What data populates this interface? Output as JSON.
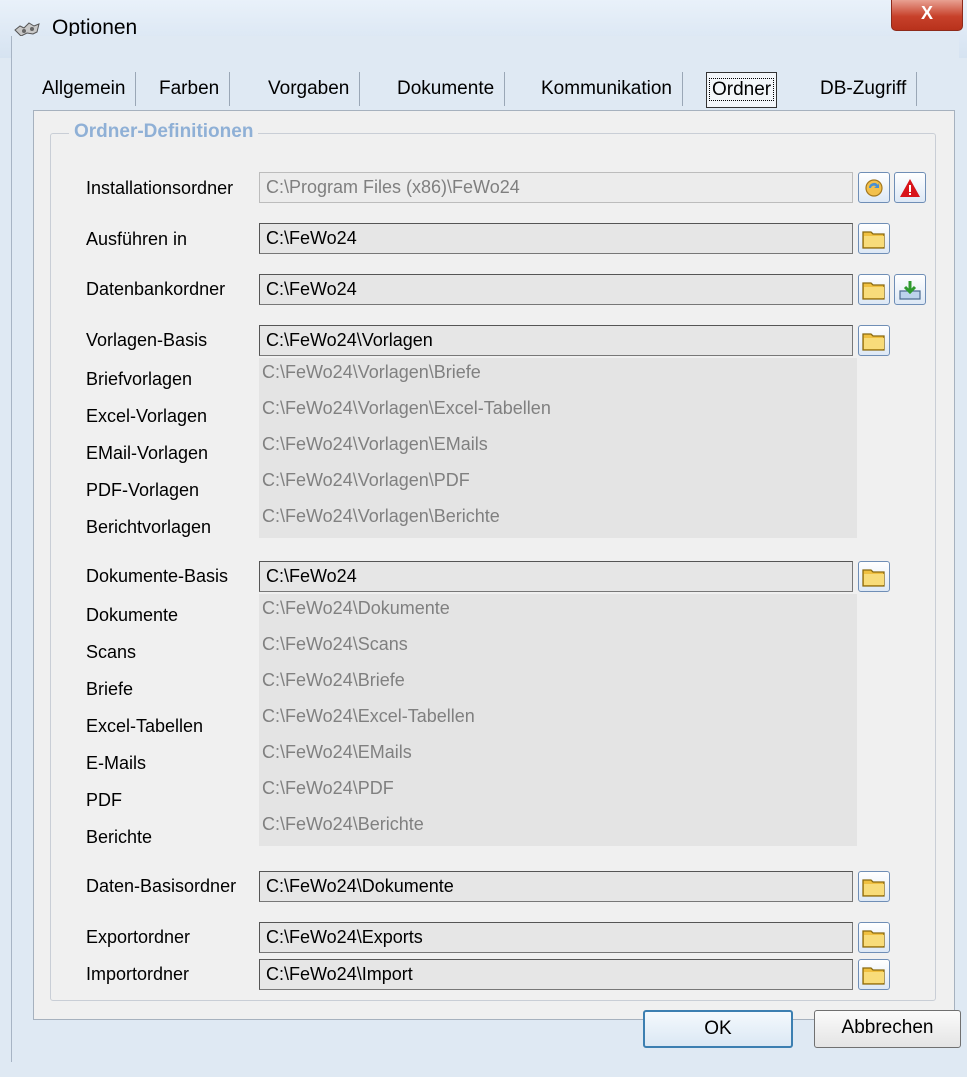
{
  "window": {
    "title": "Optionen",
    "close_label": "X"
  },
  "tabs": [
    {
      "label": "Allgemein"
    },
    {
      "label": "Farben"
    },
    {
      "label": "Vorgaben"
    },
    {
      "label": "Dokumente"
    },
    {
      "label": "Kommunikation"
    },
    {
      "label": "Ordner",
      "active": true
    },
    {
      "label": "DB-Zugriff"
    }
  ],
  "group": {
    "title": "Ordner-Definitionen",
    "rows": {
      "installationsordner": {
        "label": "Installationsordner",
        "value": "C:\\Program Files (x86)\\FeWo24"
      },
      "ausfuehren_in": {
        "label": "Ausführen in",
        "value": "C:\\FeWo24"
      },
      "datenbankordner": {
        "label": "Datenbankordner",
        "value": "C:\\FeWo24"
      },
      "vorlagen_basis": {
        "label": "Vorlagen-Basis",
        "value": "C:\\FeWo24\\Vorlagen"
      },
      "briefvorlagen": {
        "label": "Briefvorlagen",
        "value": "C:\\FeWo24\\Vorlagen\\Briefe"
      },
      "excel_vorlagen": {
        "label": "Excel-Vorlagen",
        "value": "C:\\FeWo24\\Vorlagen\\Excel-Tabellen"
      },
      "email_vorlagen": {
        "label": "EMail-Vorlagen",
        "value": "C:\\FeWo24\\Vorlagen\\EMails"
      },
      "pdf_vorlagen": {
        "label": "PDF-Vorlagen",
        "value": "C:\\FeWo24\\Vorlagen\\PDF"
      },
      "berichtvorlagen": {
        "label": "Berichtvorlagen",
        "value": "C:\\FeWo24\\Vorlagen\\Berichte"
      },
      "dokumente_basis": {
        "label": "Dokumente-Basis",
        "value": "C:\\FeWo24"
      },
      "dokumente": {
        "label": "Dokumente",
        "value": "C:\\FeWo24\\Dokumente"
      },
      "scans": {
        "label": "Scans",
        "value": "C:\\FeWo24\\Scans"
      },
      "briefe": {
        "label": "Briefe",
        "value": "C:\\FeWo24\\Briefe"
      },
      "excel_tabellen": {
        "label": "Excel-Tabellen",
        "value": "C:\\FeWo24\\Excel-Tabellen"
      },
      "emails": {
        "label": "E-Mails",
        "value": "C:\\FeWo24\\EMails"
      },
      "pdf": {
        "label": "PDF",
        "value": "C:\\FeWo24\\PDF"
      },
      "berichte": {
        "label": "Berichte",
        "value": "C:\\FeWo24\\Berichte"
      },
      "daten_basisordner": {
        "label": "Daten-Basisordner",
        "value": "C:\\FeWo24\\Dokumente"
      },
      "exportordner": {
        "label": "Exportordner",
        "value": "C:\\FeWo24\\Exports"
      },
      "importordner": {
        "label": "Importordner",
        "value": "C:\\FeWo24\\Import"
      }
    }
  },
  "buttons": {
    "ok": "OK",
    "cancel": "Abbrechen"
  },
  "colors": {
    "group_title": "#8fb0d6",
    "folder_icon": "#f3c94a",
    "warning_icon": "#d8141b",
    "close_button": "#c7402a"
  }
}
